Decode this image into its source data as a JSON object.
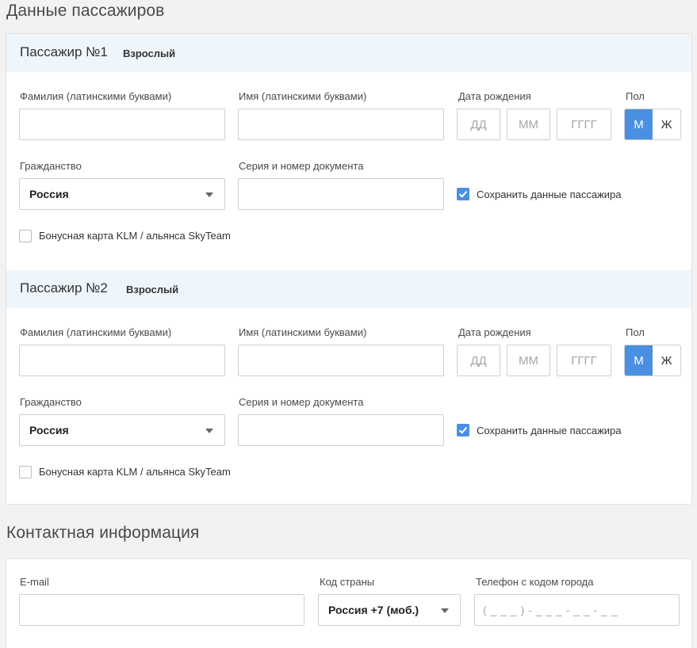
{
  "passengers_section": {
    "title": "Данные пассажиров"
  },
  "labels": {
    "surname": "Фамилия (латинскими буквами)",
    "name": "Имя (латинскими буквами)",
    "birthdate": "Дата рождения",
    "gender": "Пол",
    "citizenship": "Гражданство",
    "document": "Серия и номер документа",
    "save_passenger": "Сохранить данные пассажира",
    "bonus_card": "Бонусная карта KLM / альянса SkyTeam"
  },
  "date_placeholders": {
    "day": "ДД",
    "month": "ММ",
    "year": "ГГГГ"
  },
  "gender_options": {
    "male": "М",
    "female": "Ж"
  },
  "passengers": [
    {
      "title": "Пассажир №1",
      "type": "Взрослый",
      "surname": "",
      "name": "",
      "citizenship": "Россия",
      "document": "",
      "gender_selected": "М",
      "save_checked": true,
      "bonus_checked": false
    },
    {
      "title": "Пассажир №2",
      "type": "Взрослый",
      "surname": "",
      "name": "",
      "citizenship": "Россия",
      "document": "",
      "gender_selected": "М",
      "save_checked": true,
      "bonus_checked": false
    }
  ],
  "contact_section": {
    "title": "Контактная информация",
    "email_label": "E-mail",
    "email_value": "",
    "country_code_label": "Код страны",
    "country_code_value": "Россия +7 (моб.)",
    "phone_label": "Телефон с кодом города",
    "phone_placeholder": "( _ _ _ ) - _ _ _ - _ _ - _ _"
  },
  "colors": {
    "accent": "#4a90e2",
    "header_bg": "#eef5fb",
    "page_bg": "#f2f2f2"
  }
}
